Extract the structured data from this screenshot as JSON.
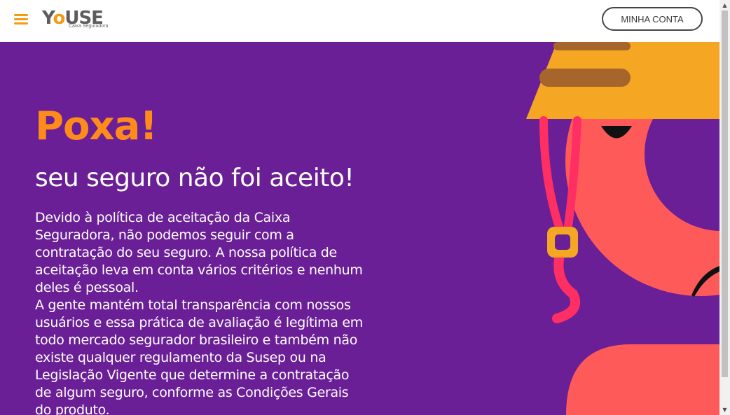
{
  "header": {
    "logo_text_1": "Y",
    "logo_text_o": "o",
    "logo_text_2": "USE",
    "logo_sub": "Caixa Seguradora",
    "account_button": "MINHA CONTA",
    "menu_icon": "hamburger-menu-icon",
    "accent_color": "#f49b12"
  },
  "hero": {
    "title": "Poxa!",
    "subtitle": "seu seguro não foi aceito!",
    "paragraph_1": "Devido à política de aceitação da Caixa Seguradora, não podemos seguir com a contratação do seu seguro. A nossa política de aceitação leva em conta vários critérios e nenhum deles é pessoal.",
    "paragraph_2": "A gente mantém total transparência com nossos usuários e essa prática de avaliação é legítima em todo mercado segurador brasileiro e também não existe qualquer regulamento da Susep ou na Legislação Vigente que determine a contratação de algum seguro, conforme as Condições Gerais do produto.",
    "background_color": "#6b1f96",
    "title_color": "#ff8c1a"
  },
  "scrollbar": {
    "up_icon": "▲",
    "down_icon": "▼"
  }
}
